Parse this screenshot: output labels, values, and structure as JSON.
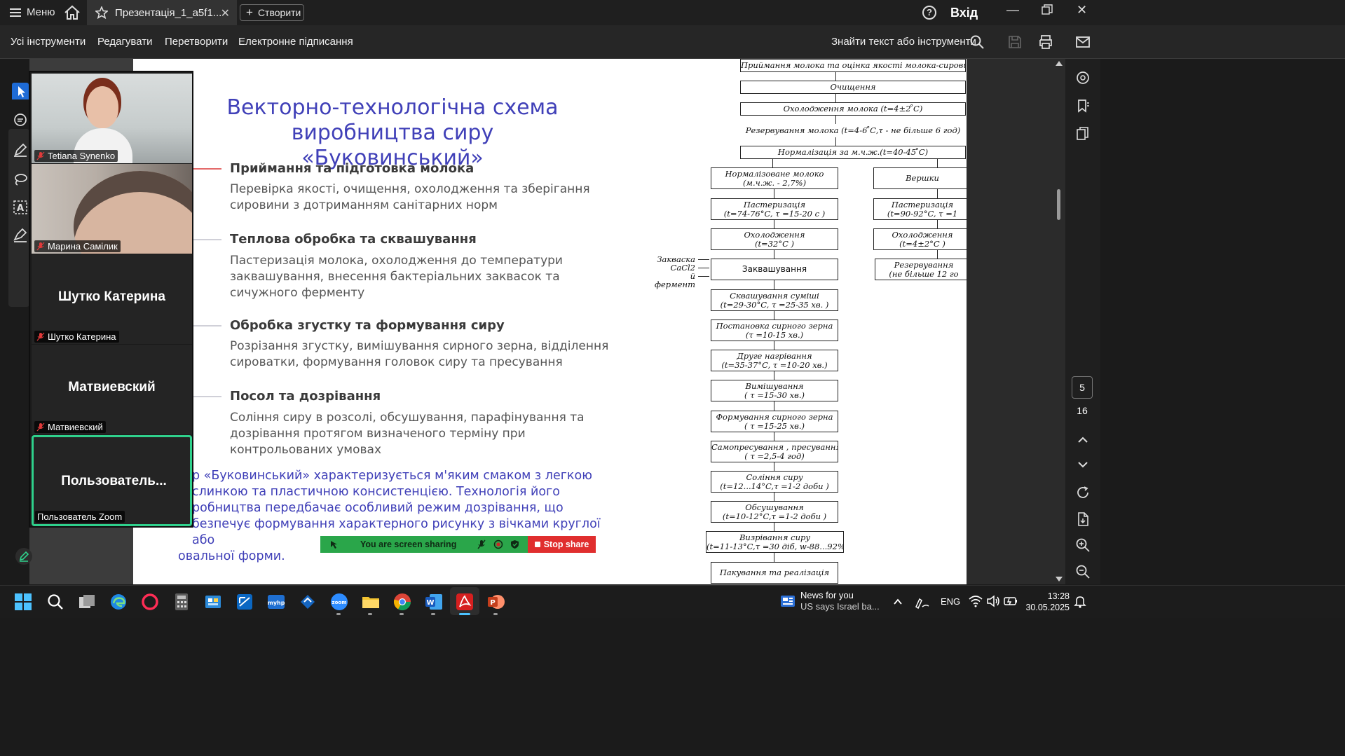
{
  "titlebar": {
    "menu_label": "Меню",
    "tab_title": "Презентація_1_a5f1...",
    "create_label": "Створити",
    "signin_label": "Вхід"
  },
  "toolbar": {
    "items": [
      "Усі інструменти",
      "Редагувати",
      "Перетворити",
      "Електронне підписання"
    ],
    "find_label": "Знайти текст або інструменти"
  },
  "slide": {
    "title_line1": "Векторно-технологічна схема",
    "title_line2": "виробництва сиру «Буковинський»",
    "sections": [
      {
        "head": "Приймання та підготовка молока",
        "body1": "Перевірка якості, очищення, охолодження та зберігання",
        "body2": "сировини з дотриманням санітарних норм",
        "body3": ""
      },
      {
        "head": "Теплова обробка та сквашування",
        "body1": "Пастеризація молока, охолодження до температури",
        "body2": "заквашування, внесення бактеріальних заквасок та",
        "body3": "сичужного ферменту"
      },
      {
        "head": "Обробка згустку та формування сиру",
        "body1": "Розрізання згустку, вимішування сирного зерна, відділення",
        "body2": "сироватки, формування головок сиру та пресування",
        "body3": ""
      },
      {
        "head": "Посол та дозрівання",
        "body1": "Соління сиру в розсолі, обсушування, парафінування та",
        "body2": "дозрівання протягом визначеного терміну при",
        "body3": "контрольованих умовах"
      }
    ],
    "closing_1": "р «Буковинський» характеризується м'яким смаком з легкою",
    "closing_2": "слинкою та пластичною консистенцією. Технологія його",
    "closing_3": "робництва передбачає особливий режим дозрівання, що",
    "closing_4": "безпечує формування характерного рисунку з вічками круглої або",
    "closing_5": "овальної форми."
  },
  "diagram": {
    "top_boxes": [
      "Приймання молока та оцінка якості молока-сировини",
      "Очищення",
      "Охолодження молока (t=4±2 ̊С)",
      "Резервування молока (t=4-6 ̊С,τ - не більше 6 год)",
      "Нормалізація за м.ч.ж.(t=40-45 ̊С)"
    ],
    "left_boxes": [
      [
        "Нормалізоване молоко",
        "(м.ч.ж. - 2,7%)"
      ],
      [
        "Пастеризація",
        "(t=74-76°C, τ =15-20 с )"
      ],
      [
        "Охолодження",
        "(t=32°C )"
      ],
      [
        "Заквашування",
        ""
      ],
      [
        "Сквашування суміші",
        "(t=29-30°C, τ =25-35 хв. )"
      ],
      [
        "Постановка сирного зерна",
        "(τ =10-15 хв.)"
      ],
      [
        "Друге нагрівання",
        "(t=35-37°C, τ =10-20 хв.)"
      ],
      [
        "Вимішування",
        "( τ =15-30 хв.)"
      ],
      [
        "Формування сирного зерна",
        "( τ =15-25 хв.)"
      ],
      [
        "Самопресування , пресування",
        "( τ =2,5-4 год)"
      ],
      [
        "Соління сиру",
        "(t=12...14°C,τ =1-2 доби )"
      ],
      [
        "Обсушування",
        "(t=10-12°C,τ =1-2 доби )"
      ],
      [
        "Визрівання сиру",
        "(t=11-13°C,τ =30 діб, w-88...92% )"
      ],
      [
        "Пакування та реалізація",
        ""
      ]
    ],
    "right_boxes": [
      [
        "Вершки",
        ""
      ],
      [
        "Пастеризація",
        "(t=90-92°C, τ =1"
      ],
      [
        "Охолодження",
        "(t=4±2°C )"
      ],
      [
        "Резервування",
        "(не більше 12 го"
      ]
    ],
    "side_labels": [
      "Закваска",
      "CaCl2",
      "й фермент"
    ]
  },
  "zoom": {
    "participants": [
      {
        "label": "Tetiana Synenko",
        "big": ""
      },
      {
        "label": "Марина Самілик",
        "big": ""
      },
      {
        "label": "Шутко Катерина",
        "big": "Шутко Катерина"
      },
      {
        "label": "Матвиевский",
        "big": "Матвиевский"
      },
      {
        "label": "Пользователь Zoom",
        "big": "Пользователь..."
      }
    ],
    "share_text": "You are screen sharing",
    "stop_share": "Stop share"
  },
  "pager": {
    "current": "5",
    "total": "16"
  },
  "taskbar": {
    "news_title": "News for you",
    "news_sub": "US says Israel ba...",
    "lang": "ENG",
    "time": "13:28",
    "date": "30.05.2025"
  }
}
